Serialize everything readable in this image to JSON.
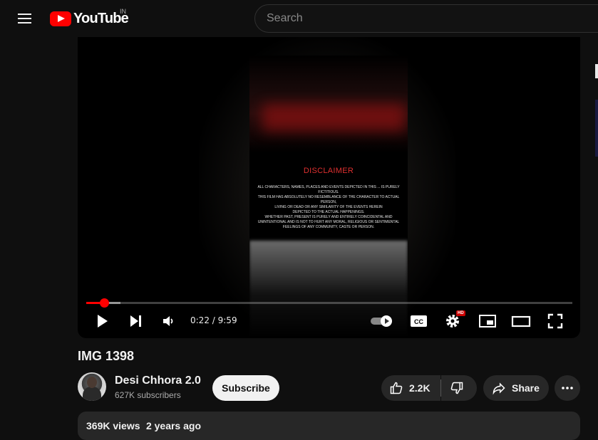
{
  "header": {
    "logo_text": "YouTube",
    "country_code": "IN",
    "search_placeholder": "Search"
  },
  "player": {
    "disclaimer_title": "DISCLAIMER",
    "disclaimer_lines": [
      "ALL CHARACTERS, NAMES, PLACES AND EVENTS DEPICTED IN THIS ... IS PURELY FICTITIOUS.",
      "THIS FILM HAS ABSOLUTELY NO RESEMBLANCE OF THE CHARACTER TO ACTUAL PERSON,",
      "LIVING OR DEAD OR ANY SIMILARITY OF THE EVENTS HEREIN",
      "DEPICTED TO THE ACTUAL HAPPENINGS.",
      "WHETHER PAST, PRESENT IS PURELY AND ENTIRELY COINCIDENTAL AND",
      "UNINTENTIONAL AND IS NOT TO HURT ANY MORAL, RELIGIOUS OR SENTIMENTAL",
      "FEELINGS OF ANY COMMUNITY, CASTE OR PERSON."
    ],
    "current_time": "0:22",
    "time_separator": " / ",
    "duration": "9:59",
    "played_fraction": 0.037,
    "loaded_fraction": 0.07,
    "quality_badge": "HD",
    "icons": [
      "play-icon",
      "next-icon",
      "volume-icon",
      "autoplay-toggle-icon",
      "captions-icon",
      "settings-icon",
      "miniplayer-icon",
      "theater-icon",
      "fullscreen-icon"
    ]
  },
  "video": {
    "title": "IMG 1398"
  },
  "channel": {
    "name": "Desi Chhora 2.0",
    "subscribers": "627K subscribers",
    "subscribe_label": "Subscribe"
  },
  "actions": {
    "like_count": "2.2K",
    "share_label": "Share"
  },
  "description": {
    "views": "369K views",
    "posted": "2 years ago"
  },
  "colors": {
    "accent": "#ff0000",
    "background": "#0f0f0f",
    "pill": "#272727"
  }
}
